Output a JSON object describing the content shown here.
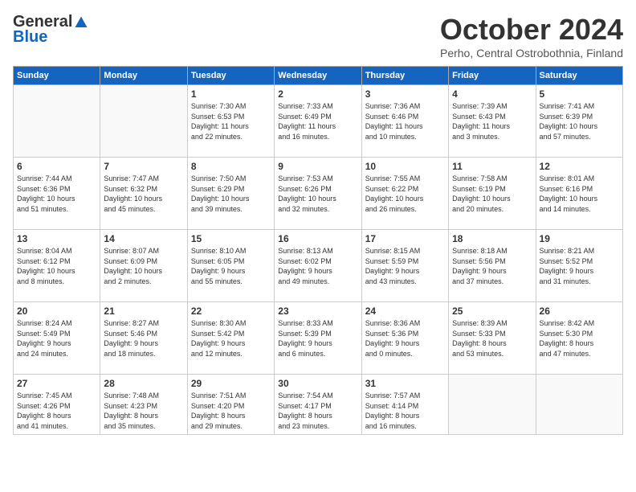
{
  "header": {
    "logo": {
      "general": "General",
      "blue": "Blue"
    },
    "title": "October 2024",
    "location": "Perho, Central Ostrobothnia, Finland"
  },
  "days_of_week": [
    "Sunday",
    "Monday",
    "Tuesday",
    "Wednesday",
    "Thursday",
    "Friday",
    "Saturday"
  ],
  "weeks": [
    [
      {
        "day": "",
        "info": ""
      },
      {
        "day": "",
        "info": ""
      },
      {
        "day": "1",
        "info": "Sunrise: 7:30 AM\nSunset: 6:53 PM\nDaylight: 11 hours\nand 22 minutes."
      },
      {
        "day": "2",
        "info": "Sunrise: 7:33 AM\nSunset: 6:49 PM\nDaylight: 11 hours\nand 16 minutes."
      },
      {
        "day": "3",
        "info": "Sunrise: 7:36 AM\nSunset: 6:46 PM\nDaylight: 11 hours\nand 10 minutes."
      },
      {
        "day": "4",
        "info": "Sunrise: 7:39 AM\nSunset: 6:43 PM\nDaylight: 11 hours\nand 3 minutes."
      },
      {
        "day": "5",
        "info": "Sunrise: 7:41 AM\nSunset: 6:39 PM\nDaylight: 10 hours\nand 57 minutes."
      }
    ],
    [
      {
        "day": "6",
        "info": "Sunrise: 7:44 AM\nSunset: 6:36 PM\nDaylight: 10 hours\nand 51 minutes."
      },
      {
        "day": "7",
        "info": "Sunrise: 7:47 AM\nSunset: 6:32 PM\nDaylight: 10 hours\nand 45 minutes."
      },
      {
        "day": "8",
        "info": "Sunrise: 7:50 AM\nSunset: 6:29 PM\nDaylight: 10 hours\nand 39 minutes."
      },
      {
        "day": "9",
        "info": "Sunrise: 7:53 AM\nSunset: 6:26 PM\nDaylight: 10 hours\nand 32 minutes."
      },
      {
        "day": "10",
        "info": "Sunrise: 7:55 AM\nSunset: 6:22 PM\nDaylight: 10 hours\nand 26 minutes."
      },
      {
        "day": "11",
        "info": "Sunrise: 7:58 AM\nSunset: 6:19 PM\nDaylight: 10 hours\nand 20 minutes."
      },
      {
        "day": "12",
        "info": "Sunrise: 8:01 AM\nSunset: 6:16 PM\nDaylight: 10 hours\nand 14 minutes."
      }
    ],
    [
      {
        "day": "13",
        "info": "Sunrise: 8:04 AM\nSunset: 6:12 PM\nDaylight: 10 hours\nand 8 minutes."
      },
      {
        "day": "14",
        "info": "Sunrise: 8:07 AM\nSunset: 6:09 PM\nDaylight: 10 hours\nand 2 minutes."
      },
      {
        "day": "15",
        "info": "Sunrise: 8:10 AM\nSunset: 6:05 PM\nDaylight: 9 hours\nand 55 minutes."
      },
      {
        "day": "16",
        "info": "Sunrise: 8:13 AM\nSunset: 6:02 PM\nDaylight: 9 hours\nand 49 minutes."
      },
      {
        "day": "17",
        "info": "Sunrise: 8:15 AM\nSunset: 5:59 PM\nDaylight: 9 hours\nand 43 minutes."
      },
      {
        "day": "18",
        "info": "Sunrise: 8:18 AM\nSunset: 5:56 PM\nDaylight: 9 hours\nand 37 minutes."
      },
      {
        "day": "19",
        "info": "Sunrise: 8:21 AM\nSunset: 5:52 PM\nDaylight: 9 hours\nand 31 minutes."
      }
    ],
    [
      {
        "day": "20",
        "info": "Sunrise: 8:24 AM\nSunset: 5:49 PM\nDaylight: 9 hours\nand 24 minutes."
      },
      {
        "day": "21",
        "info": "Sunrise: 8:27 AM\nSunset: 5:46 PM\nDaylight: 9 hours\nand 18 minutes."
      },
      {
        "day": "22",
        "info": "Sunrise: 8:30 AM\nSunset: 5:42 PM\nDaylight: 9 hours\nand 12 minutes."
      },
      {
        "day": "23",
        "info": "Sunrise: 8:33 AM\nSunset: 5:39 PM\nDaylight: 9 hours\nand 6 minutes."
      },
      {
        "day": "24",
        "info": "Sunrise: 8:36 AM\nSunset: 5:36 PM\nDaylight: 9 hours\nand 0 minutes."
      },
      {
        "day": "25",
        "info": "Sunrise: 8:39 AM\nSunset: 5:33 PM\nDaylight: 8 hours\nand 53 minutes."
      },
      {
        "day": "26",
        "info": "Sunrise: 8:42 AM\nSunset: 5:30 PM\nDaylight: 8 hours\nand 47 minutes."
      }
    ],
    [
      {
        "day": "27",
        "info": "Sunrise: 7:45 AM\nSunset: 4:26 PM\nDaylight: 8 hours\nand 41 minutes."
      },
      {
        "day": "28",
        "info": "Sunrise: 7:48 AM\nSunset: 4:23 PM\nDaylight: 8 hours\nand 35 minutes."
      },
      {
        "day": "29",
        "info": "Sunrise: 7:51 AM\nSunset: 4:20 PM\nDaylight: 8 hours\nand 29 minutes."
      },
      {
        "day": "30",
        "info": "Sunrise: 7:54 AM\nSunset: 4:17 PM\nDaylight: 8 hours\nand 23 minutes."
      },
      {
        "day": "31",
        "info": "Sunrise: 7:57 AM\nSunset: 4:14 PM\nDaylight: 8 hours\nand 16 minutes."
      },
      {
        "day": "",
        "info": ""
      },
      {
        "day": "",
        "info": ""
      }
    ]
  ]
}
